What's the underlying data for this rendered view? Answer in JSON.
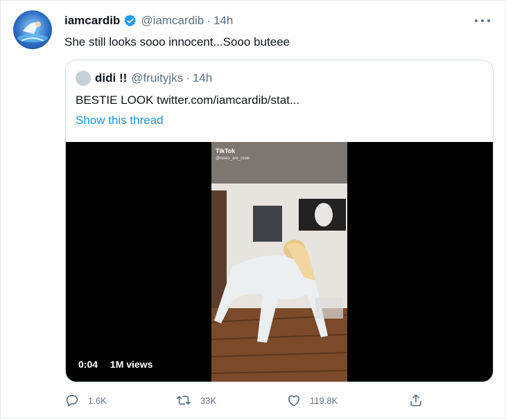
{
  "tweet": {
    "name": "iamcardib",
    "handle": "@iamcardib",
    "separator": "·",
    "time": "14h",
    "text": "She still looks sooo innocent...Sooo buteee"
  },
  "quoted": {
    "name": "didi !!",
    "handle": "@fruityjks",
    "separator": "·",
    "time": "14h",
    "text": "BESTIE LOOK  twitter.com/iamcardib/stat...",
    "show_thread": "Show this thread"
  },
  "video": {
    "watermark": "TikTok",
    "watermark_handle": "@roses_are_rosie",
    "elapsed": "0:04",
    "views": "1M views"
  },
  "actions": {
    "replies": "1.6K",
    "retweets": "33K",
    "likes": "119.8K"
  },
  "icons": [
    "verified-badge-icon",
    "more-icon",
    "reply-icon",
    "retweet-icon",
    "like-icon",
    "share-icon"
  ],
  "colors": {
    "accent": "#1b95e0",
    "secondary_text": "#5b7083",
    "border": "#cfd9de"
  }
}
